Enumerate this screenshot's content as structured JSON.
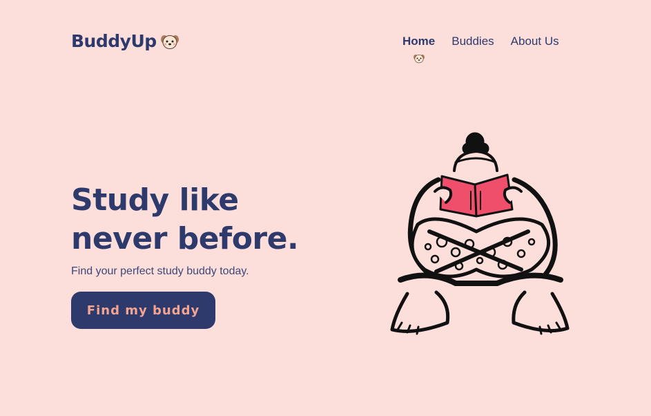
{
  "brand": {
    "name": "BuddyUp",
    "icon": "dog-face-icon"
  },
  "nav": {
    "items": [
      {
        "label": "Home",
        "active": true
      },
      {
        "label": "Buddies",
        "active": false
      },
      {
        "label": "About Us",
        "active": false
      }
    ]
  },
  "hero": {
    "title": "Study like never before.",
    "subtitle": "Find your perfect study buddy today.",
    "cta_label": "Find my buddy"
  },
  "illustration": {
    "icon": "person-reading-book-illustration"
  },
  "colors": {
    "background": "#fcdfdb",
    "primary": "#2e3a6c",
    "accent": "#f4a592",
    "book": "#ef4f6b"
  }
}
